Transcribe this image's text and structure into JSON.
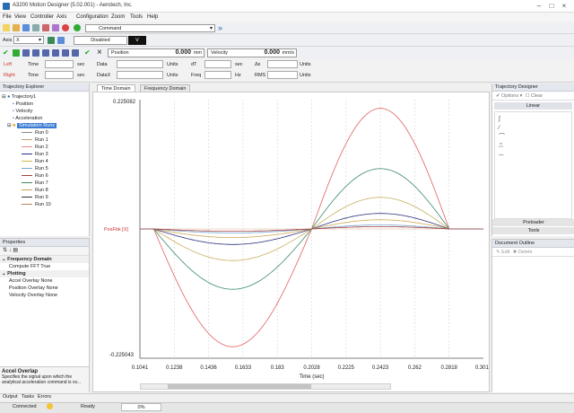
{
  "window": {
    "title": "A3200 Motion Designer (5.02.001) - Aerotech, Inc."
  },
  "menu": [
    "File",
    "View",
    "Controller",
    "Axis",
    "Configuration",
    "Zoom",
    "Tools",
    "Help"
  ],
  "toolbar": {
    "command_placeholder": "Command"
  },
  "axisbar": {
    "axis_label": "Axis",
    "axis_value": "X",
    "state": "Disabled",
    "v_label": "V"
  },
  "motionbar": {
    "position_label": "Position",
    "position_value": "0.000",
    "position_unit": "mm",
    "velocity_label": "Velocity",
    "velocity_value": "0.000",
    "velocity_unit": "mm/s"
  },
  "cursors": {
    "left_label": "Left",
    "right_label": "Right",
    "time_label": "Time",
    "sec_unit": "sec",
    "data_label": "Data",
    "units_label": "Units",
    "dt_label": "dT",
    "dx_label": "Δx",
    "freq_label": "Freq",
    "hz_unit": "Hz",
    "rms_label": "RMS",
    "datax_label": "DataX"
  },
  "trajectory_explorer": {
    "title": "Trajectory Explorer",
    "root": "Trajectory1",
    "items": [
      "Position",
      "Velocity",
      "Acceleration"
    ],
    "selection": "Simulation Runs",
    "runs": [
      {
        "name": "Run 0",
        "color": "#888888"
      },
      {
        "name": "Run 1",
        "color": "#c1a27c"
      },
      {
        "name": "Run 2",
        "color": "#e58a8a"
      },
      {
        "name": "Run 3",
        "color": "#2a2a8a"
      },
      {
        "name": "Run 4",
        "color": "#d6b34a"
      },
      {
        "name": "Run 5",
        "color": "#7aa6d6"
      },
      {
        "name": "Run 6",
        "color": "#a04040"
      },
      {
        "name": "Run 7",
        "color": "#3a8a5a"
      },
      {
        "name": "Run 8",
        "color": "#caa050"
      },
      {
        "name": "Run 9",
        "color": "#333333"
      },
      {
        "name": "Run 10",
        "color": "#c08050"
      }
    ]
  },
  "properties": {
    "title": "Properties",
    "sections": [
      {
        "name": "Frequency Domain",
        "rows": [
          "Compute FFT True"
        ]
      },
      {
        "name": "Plotting",
        "rows": [
          "Accel Overlay None",
          "Position Overlay None",
          "Velocity Overlay None"
        ]
      }
    ],
    "help_title": "Accel Overlap",
    "help_text": "Specifies the signal upon which the analytical acceleration command is ov..."
  },
  "tabs": [
    "Time Domain",
    "Frequency Domain"
  ],
  "chart_data": {
    "type": "line",
    "xlabel": "Time (sec)",
    "ylabel": "PosFbk [X]",
    "x_ticks": [
      "0.1041",
      "0.1238",
      "0.1436",
      "0.1633",
      "0.183",
      "0.2028",
      "0.2225",
      "0.2423",
      "0.262",
      "0.2818",
      "0.3015"
    ],
    "y_top_label": "0.225082",
    "y_bottom_label": "-0.225043",
    "xlim": [
      0.1041,
      0.3015
    ],
    "ylim": [
      -0.225043,
      0.225082
    ],
    "grid": true,
    "series": [
      {
        "color": "#e06060",
        "min": -0.205,
        "max": 0.21,
        "min_x": 0.1535,
        "max_x": 0.2423
      },
      {
        "color": "#3a8a6a",
        "min": -0.105,
        "max": 0.105,
        "min_x": 0.153,
        "max_x": 0.2423
      },
      {
        "color": "#c8b060",
        "min": -0.055,
        "max": 0.055,
        "min_x": 0.152,
        "max_x": 0.2423
      },
      {
        "color": "#303080",
        "min": -0.027,
        "max": 0.027,
        "min_x": 0.151,
        "max_x": 0.2423
      },
      {
        "color": "#d0a850",
        "min": -0.015,
        "max": 0.016,
        "min_x": 0.15,
        "max_x": 0.2423
      },
      {
        "color": "#7aa6d6",
        "min": -0.007,
        "max": 0.007,
        "min_x": 0.149,
        "max_x": 0.2423
      },
      {
        "color": "#a04040",
        "min": -0.004,
        "max": 0.004,
        "min_x": 0.148,
        "max_x": 0.2423
      }
    ]
  },
  "trajectory_designer": {
    "title": "Trajectory Designer",
    "options": "Options",
    "clear": "Clear",
    "section": "Linear",
    "bottom_tabs": [
      "Preloader",
      "Tools"
    ]
  },
  "document_outline": {
    "title": "Document Outline",
    "edit": "Edit",
    "delete": "Delete"
  },
  "bottom_tabs": [
    "Output",
    "Tasks",
    "Errors"
  ],
  "status": {
    "connection": "Connected",
    "ready": "Ready",
    "progress": "0%"
  }
}
